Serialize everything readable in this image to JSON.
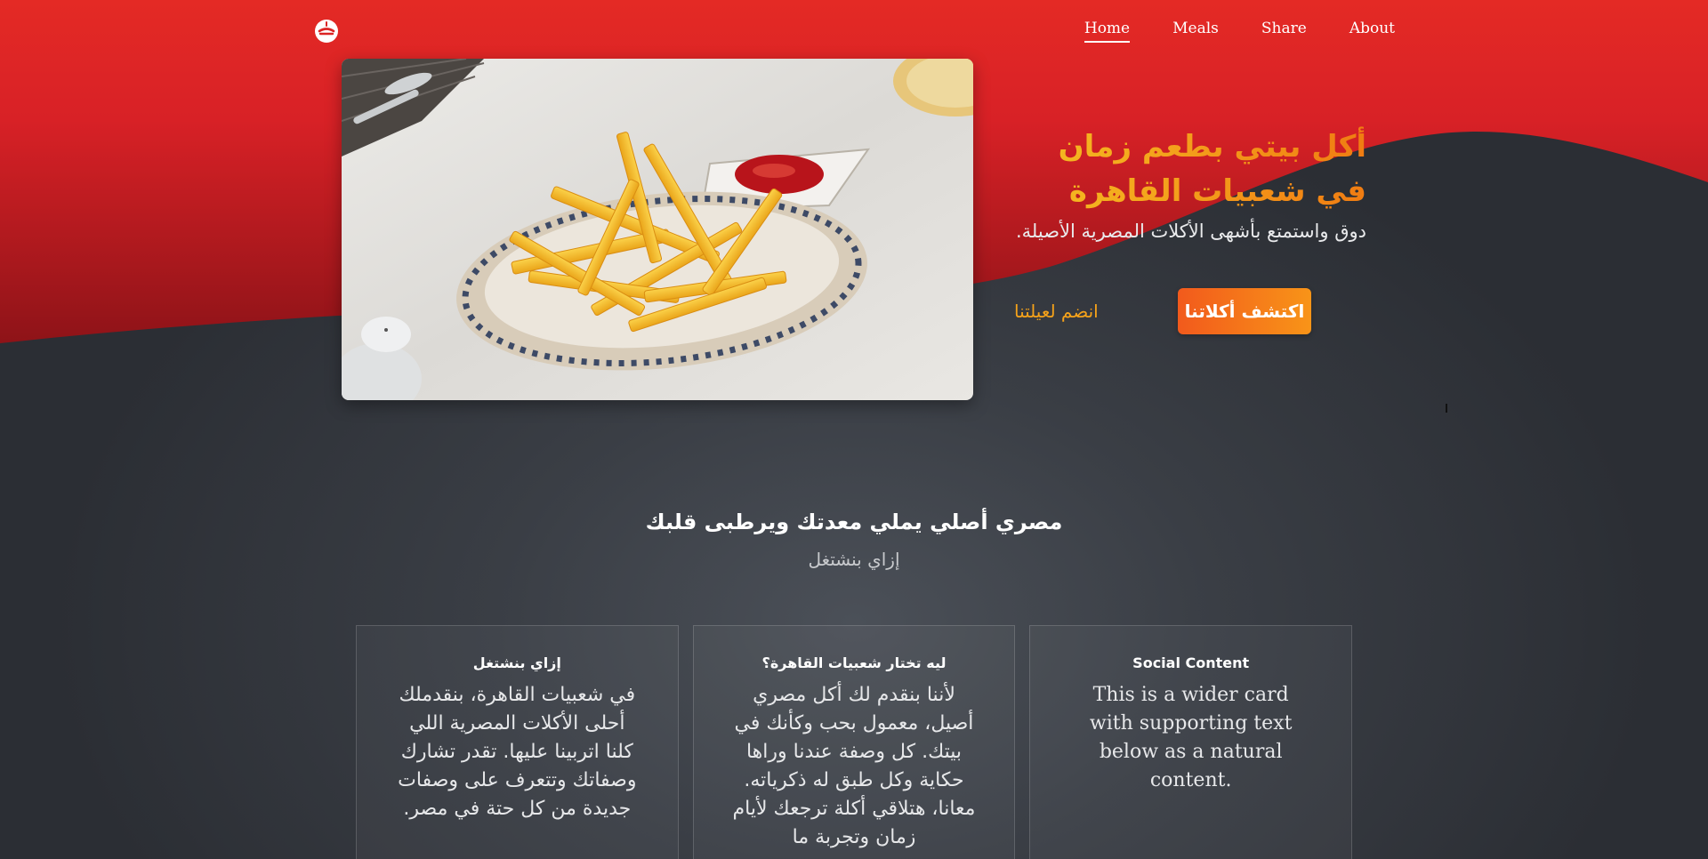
{
  "nav": {
    "logo_icon": "bowl-icon",
    "links": [
      {
        "label": "Home",
        "active": true
      },
      {
        "label": "Meals",
        "active": false
      },
      {
        "label": "Share",
        "active": false
      },
      {
        "label": "About",
        "active": false
      }
    ]
  },
  "hero": {
    "image_icon": "french-fries-photo",
    "title": "أكل بيتي بطعم زمان في شعبيات القاهرة",
    "subtitle": "دوق واستمتع بأشهى الأكلات المصرية الأصيلة.",
    "primary_button": "اكتشف أكلاتنا",
    "secondary_link": "انضم لعيلتنا"
  },
  "section": {
    "title": "مصري أصلي يملي معدتك ويرطبى قلبك",
    "subtitle": "إزاي بنشتغل"
  },
  "cards": [
    {
      "title": "إزاي بنشتغل",
      "text": "في شعبيات القاهرة، بنقدملك أحلى الأكلات المصرية اللي كلنا اتربينا عليها. تقدر تشارك وصفاتك وتتعرف على وصفات جديدة من كل حتة في مصر."
    },
    {
      "title": "ليه تختار شعبيات القاهرة؟",
      "text": "لأننا بنقدم لك أكل مصري أصيل، معمول بحب وكأنك في بيتك. كل وصفة عندنا وراها حكاية وكل طبق له ذكرياته. معانا، هتلاقي أكلة ترجعك لأيام زمان وتجربة ما"
    },
    {
      "title": "Social Content",
      "text": "This is a wider card with supporting text below as a natural content."
    }
  ],
  "colors": {
    "brand_red": "#dc2424",
    "dark_bg": "#2b2e34",
    "accent_orange": "#f58a1a",
    "title_gold": "#f5c022"
  }
}
